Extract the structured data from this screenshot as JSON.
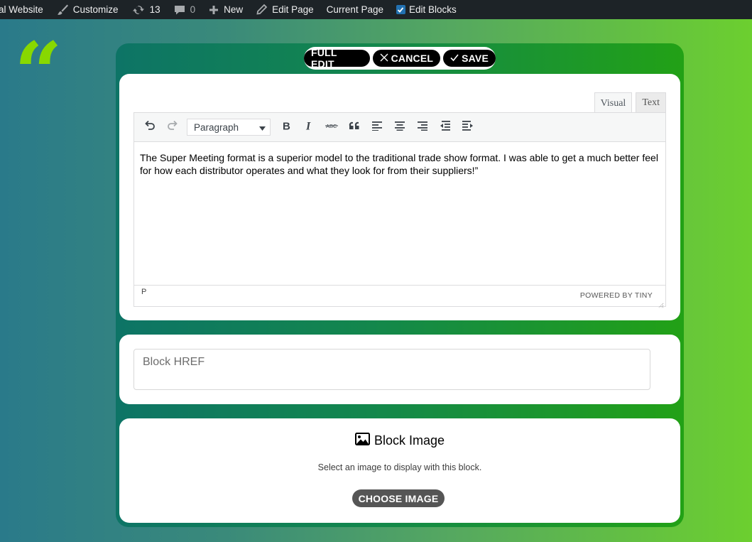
{
  "adminbar": {
    "site_label": "al Website",
    "customize_label": "Customize",
    "updates_count": "13",
    "comments_count": "0",
    "new_label": "New",
    "edit_page_label": "Edit Page",
    "current_page_label": "Current Page",
    "edit_blocks_label": "Edit Blocks"
  },
  "quote_glyph": "“",
  "actions": {
    "full_edit": "FULL EDIT",
    "cancel": "CANCEL",
    "save": "SAVE"
  },
  "editor": {
    "tab_visual": "Visual",
    "tab_text": "Text",
    "format_value": "Paragraph",
    "content": "The Super Meeting format is a superior model to the traditional trade show format. I was able to get a much better feel for how each distributor operates and what they look for from their suppliers!”",
    "path": "P",
    "powered": "POWERED BY TINY"
  },
  "href": {
    "placeholder": "Block HREF"
  },
  "image_block": {
    "title": "Block Image",
    "description": "Select an image to display with this block.",
    "button": "CHOOSE IMAGE"
  },
  "colors": {
    "admin_bar": "#1d2327",
    "quote": "#88d800",
    "panel_start": "#0d7466",
    "panel_end": "#22a116",
    "checkbox": "#2271b1"
  }
}
